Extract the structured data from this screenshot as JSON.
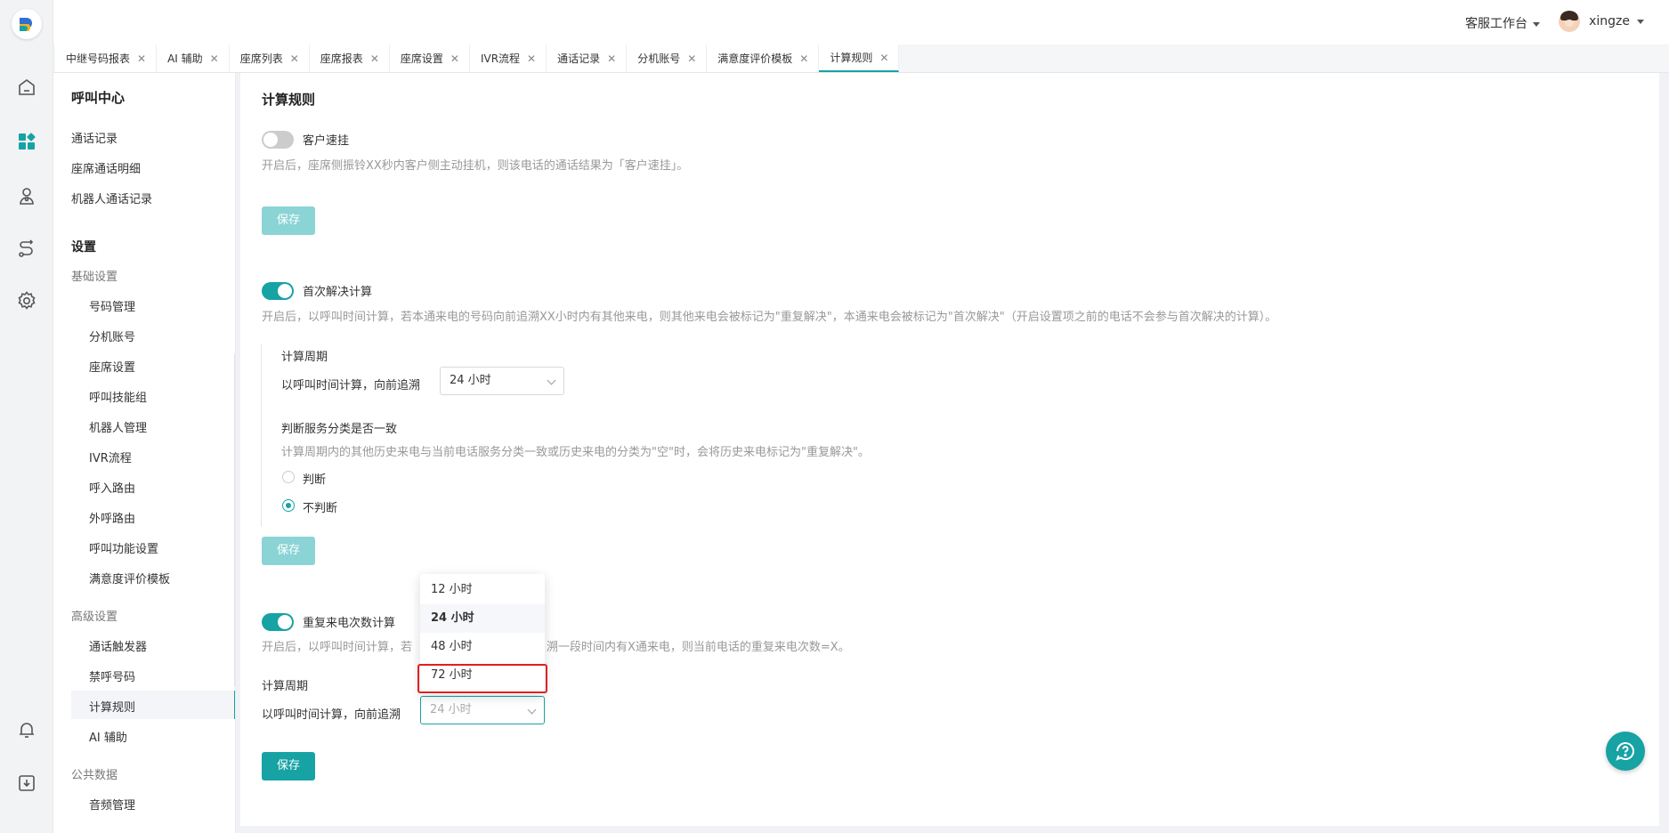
{
  "header": {
    "workspace": "客服工作台",
    "username": "xingze"
  },
  "tabs": [
    {
      "label": "中继号码报表"
    },
    {
      "label": "AI 辅助"
    },
    {
      "label": "座席列表"
    },
    {
      "label": "座席报表"
    },
    {
      "label": "座席设置"
    },
    {
      "label": "IVR流程"
    },
    {
      "label": "通话记录"
    },
    {
      "label": "分机账号"
    },
    {
      "label": "满意度评价模板"
    },
    {
      "label": "计算规则"
    }
  ],
  "sidebar": {
    "title": "呼叫中心",
    "top_items": [
      "通话记录",
      "座席通话明细",
      "机器人通话记录"
    ],
    "settings_title": "设置",
    "basic_group": "基础设置",
    "basic_items": [
      "号码管理",
      "分机账号",
      "座席设置",
      "呼叫技能组",
      "机器人管理",
      "IVR流程",
      "呼入路由",
      "外呼路由",
      "呼叫功能设置",
      "满意度评价模板"
    ],
    "advanced_group": "高级设置",
    "advanced_items": [
      "通话触发器",
      "禁呼号码",
      "计算规则",
      "AI 辅助"
    ],
    "public_group": "公共数据",
    "public_items": [
      "音频管理"
    ]
  },
  "main": {
    "title": "计算规则",
    "section1": {
      "switch_label": "客户速挂",
      "switch_on": false,
      "desc": "开启后，座席侧振铃XX秒内客户侧主动挂机，则该电话的通话结果为「客户速挂」。",
      "save": "保存"
    },
    "section2": {
      "switch_label": "首次解决计算",
      "switch_on": true,
      "desc": "开启后，以呼叫时间计算，若本通来电的号码向前追溯XX小时内有其他来电，则其他来电会被标记为\"重复解决\"，本通来电会被标记为\"首次解决\"（开启设置项之前的电话不会参与首次解决的计算）。",
      "period_title": "计算周期",
      "period_label": "以呼叫时间计算，向前追溯",
      "period_value": "24 小时",
      "judge_title": "判断服务分类是否一致",
      "judge_desc": "计算周期内的其他历史来电与当前电话服务分类一致或历史来电的分类为\"空\"时，会将历史来电标记为\"重复解决\"。",
      "radio_judge": "判断",
      "radio_nojudge": "不判断",
      "selected_radio": "不判断",
      "save": "保存"
    },
    "section3": {
      "switch_label": "重复来电次数计算",
      "switch_on": true,
      "desc_left": "开启后，以呼叫时间计算，若",
      "desc_right": "溯一段时间内有X通来电，则当前电话的重复来电次数=X。",
      "period_title": "计算周期",
      "period_label": "以呼叫时间计算，向前追溯",
      "period_value": "24 小时",
      "save": "保存"
    },
    "dropdown": {
      "options": [
        "12 小时",
        "24 小时",
        "48 小时",
        "72 小时"
      ],
      "selected": "24 小时",
      "highlighted": "72 小时"
    }
  },
  "colors": {
    "accent": "#17a2a4",
    "accent_disabled": "#8bd4d5",
    "highlight": "#e02020"
  }
}
